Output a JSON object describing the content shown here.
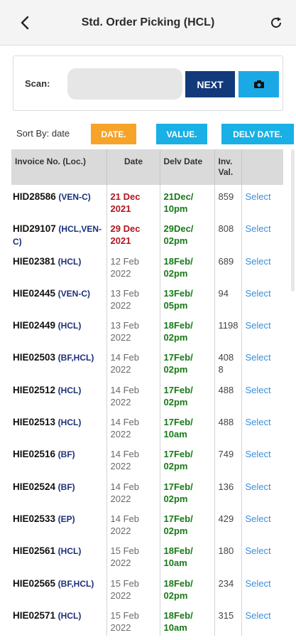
{
  "header": {
    "title": "Std. Order Picking (HCL)"
  },
  "scan": {
    "label": "Scan:",
    "value": "",
    "next_label": "NEXT"
  },
  "sort": {
    "label": "Sort By: date",
    "date_label": "DATE.",
    "value_label": "VALUE.",
    "delv_label": "DELV DATE."
  },
  "table": {
    "headers": [
      "Invoice No. (Loc.)",
      "Date",
      "Delv Date",
      "Inv. Val.",
      ""
    ],
    "rows": [
      {
        "inv": "HID28586",
        "loc": "(VEN-C)",
        "date": "21 Dec 2021",
        "delv": "21Dec/ 10pm",
        "val": "859",
        "action": "Select"
      },
      {
        "inv": "HID29107",
        "loc": "(HCL,VEN-C)",
        "date": "29 Dec 2021",
        "delv": "29Dec/ 02pm",
        "val": "808",
        "action": "Select"
      },
      {
        "inv": "HIE02381",
        "loc": "(HCL)",
        "date": "12 Feb 2022",
        "delv": "18Feb/ 02pm",
        "val": "689",
        "action": "Select"
      },
      {
        "inv": "HIE02445",
        "loc": "(VEN-C)",
        "date": "13 Feb 2022",
        "delv": "13Feb/ 05pm",
        "val": "94",
        "action": "Select"
      },
      {
        "inv": "HIE02449",
        "loc": "(HCL)",
        "date": "13 Feb 2022",
        "delv": "18Feb/ 02pm",
        "val": "1198",
        "action": "Select"
      },
      {
        "inv": "HIE02503",
        "loc": "(BF,HCL)",
        "date": "14 Feb 2022",
        "delv": "17Feb/ 02pm",
        "val": "4088",
        "action": "Select"
      },
      {
        "inv": "HIE02512",
        "loc": "(HCL)",
        "date": "14 Feb 2022",
        "delv": "17Feb/ 02pm",
        "val": "488",
        "action": "Select"
      },
      {
        "inv": "HIE02513",
        "loc": "(HCL)",
        "date": "14 Feb 2022",
        "delv": "17Feb/ 10am",
        "val": "488",
        "action": "Select"
      },
      {
        "inv": "HIE02516",
        "loc": "(BF)",
        "date": "14 Feb 2022",
        "delv": "17Feb/ 02pm",
        "val": "749",
        "action": "Select"
      },
      {
        "inv": "HIE02524",
        "loc": "(BF)",
        "date": "14 Feb 2022",
        "delv": "17Feb/ 02pm",
        "val": "136",
        "action": "Select"
      },
      {
        "inv": "HIE02533",
        "loc": "(EP)",
        "date": "14 Feb 2022",
        "delv": "17Feb/ 02pm",
        "val": "429",
        "action": "Select"
      },
      {
        "inv": "HIE02561",
        "loc": "(HCL)",
        "date": "15 Feb 2022",
        "delv": "18Feb/ 10am",
        "val": "180",
        "action": "Select"
      },
      {
        "inv": "HIE02565",
        "loc": "(BF,HCL)",
        "date": "15 Feb 2022",
        "delv": "18Feb/ 02pm",
        "val": "234",
        "action": "Select"
      },
      {
        "inv": "HIE02571",
        "loc": "(HCL)",
        "date": "15 Feb 2022",
        "delv": "18Feb/ 10am",
        "val": "315",
        "action": "Select"
      }
    ]
  }
}
